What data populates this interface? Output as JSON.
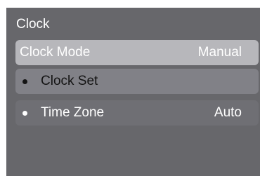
{
  "menu": {
    "title": "Clock",
    "items": [
      {
        "label": "Clock Mode",
        "value": "Manual",
        "selected": true
      },
      {
        "label": "Clock Set",
        "value": ""
      },
      {
        "label": "Time Zone",
        "value": "Auto"
      }
    ]
  },
  "colors": {
    "screen_background": "#67676b",
    "selected_row": "#b7b7bb",
    "clock_set_row": "#818187",
    "time_zone_row": "#6f6f74",
    "text_light": "#ffffff",
    "text_dark": "#141414"
  }
}
